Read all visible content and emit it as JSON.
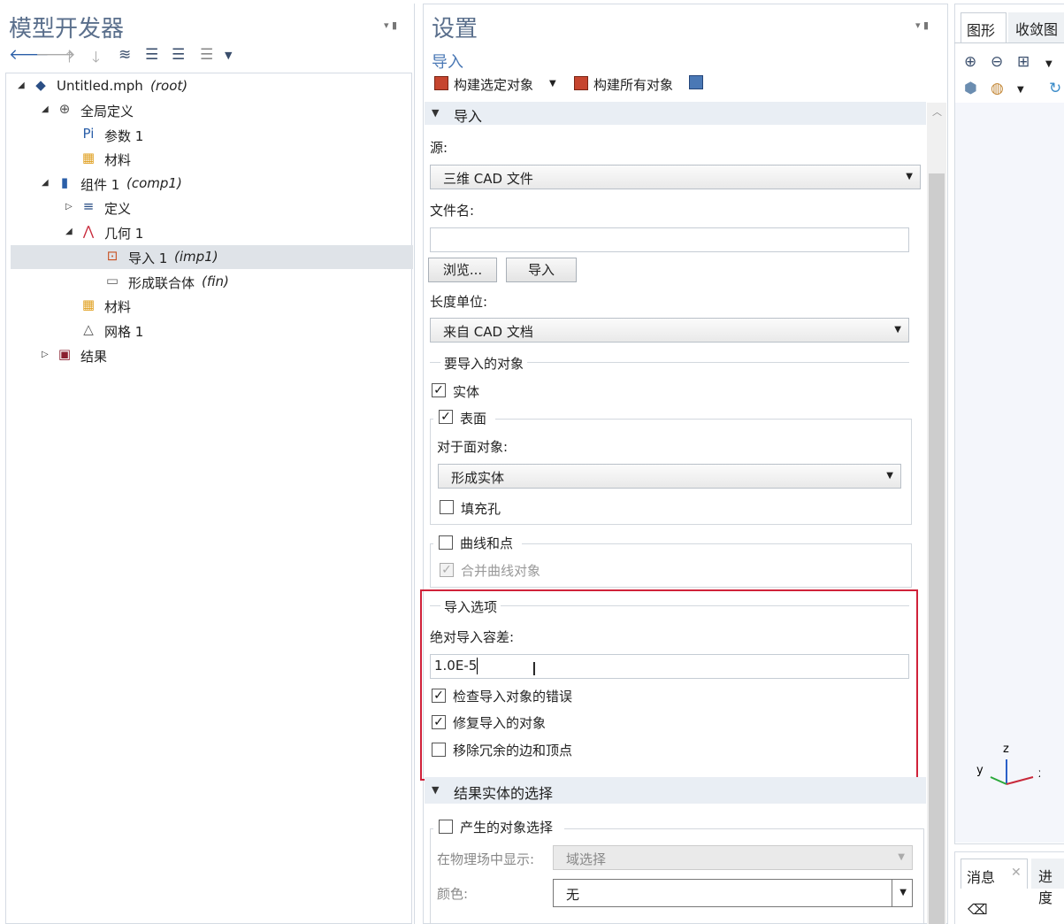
{
  "model_builder": {
    "title": "模型开发器",
    "tree": [
      {
        "label": "Untitled.mph",
        "tag": "(root)",
        "icon": "model-icon",
        "expand": "open"
      },
      {
        "label": "全局定义",
        "tag": "",
        "icon": "globe-icon",
        "expand": "open"
      },
      {
        "label": "参数 1",
        "tag": "",
        "icon": "parameters-icon",
        "expand": ""
      },
      {
        "label": "材料",
        "tag": "",
        "icon": "materials-icon",
        "expand": ""
      },
      {
        "label": "组件 1",
        "tag": "(comp1)",
        "icon": "component-icon",
        "expand": "open"
      },
      {
        "label": "定义",
        "tag": "",
        "icon": "definitions-icon",
        "expand": "closed"
      },
      {
        "label": "几何 1",
        "tag": "",
        "icon": "geometry-icon",
        "expand": "open"
      },
      {
        "label": "导入 1",
        "tag": "(imp1)",
        "icon": "import-icon",
        "expand": ""
      },
      {
        "label": "形成联合体",
        "tag": "(fin)",
        "icon": "form-union-icon",
        "expand": ""
      },
      {
        "label": "材料",
        "tag": "",
        "icon": "materials-icon",
        "expand": ""
      },
      {
        "label": "网格 1",
        "tag": "",
        "icon": "mesh-icon",
        "expand": ""
      },
      {
        "label": "结果",
        "tag": "",
        "icon": "results-icon",
        "expand": "closed"
      }
    ]
  },
  "settings": {
    "title": "设置",
    "subtitle": "导入",
    "build_selected": "构建选定对象",
    "build_all": "构建所有对象",
    "section_import": "导入",
    "source_label": "源:",
    "source_value": "三维 CAD 文件",
    "filename_label": "文件名:",
    "filename_value": "",
    "browse_button": "浏览...",
    "import_button": "导入",
    "length_unit_label": "长度单位:",
    "length_unit_value": "来自 CAD 文档",
    "objects_group": "要导入的对象",
    "solids": "实体",
    "surfaces": "表面",
    "face_objects_label": "对于面对象:",
    "face_objects_value": "形成实体",
    "fill_holes": "填充孔",
    "curves_points": "曲线和点",
    "merge_curves": "合并曲线对象",
    "import_options": "导入选项",
    "abs_tolerance_label": "绝对导入容差:",
    "abs_tolerance_value": "1.0E-5",
    "check_errors": "检查导入对象的错误",
    "repair_objects": "修复导入的对象",
    "remove_redundant": "移除冗余的边和顶点",
    "section_result_selection": "结果实体的选择",
    "resulting_selection": "产生的对象选择",
    "show_in_physics_label": "在物理场中显示:",
    "show_in_physics_value": "域选择",
    "color_label": "颜色:",
    "color_value": "无",
    "checked": {
      "solids": true,
      "surfaces": true,
      "fill_holes": false,
      "curves_points": false,
      "merge_curves": true,
      "check_errors": true,
      "repair_objects": true,
      "remove_redundant": false,
      "resulting_selection": false
    }
  },
  "graphics": {
    "tab_graphics": "图形",
    "tab_convergence": "收敛图",
    "axis_x": "x",
    "axis_y": "y",
    "axis_z": "z",
    "tab_messages": "消息",
    "tab_progress": "进度"
  },
  "colors": {
    "accent": "#4a78b5",
    "highlight_box": "#d0223a",
    "section_bg": "#e9eef4"
  }
}
